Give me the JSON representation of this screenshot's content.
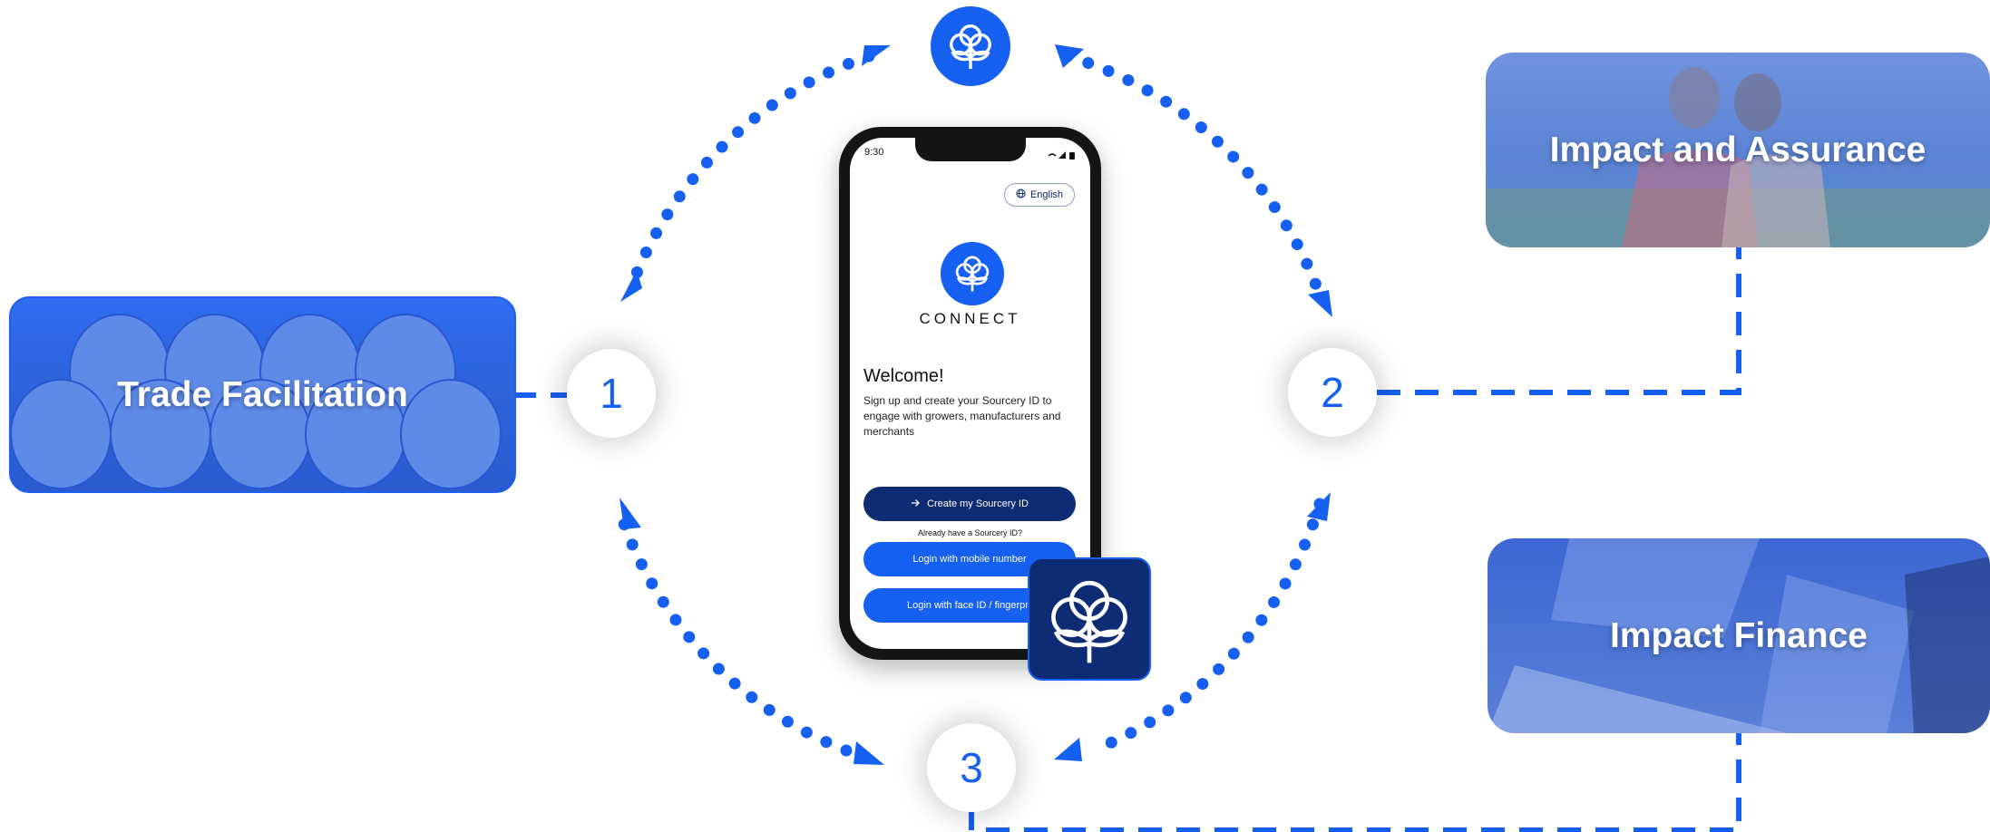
{
  "colors": {
    "accent": "#1560f0",
    "navy": "#0d2c73",
    "white": "#ffffff"
  },
  "cycle": {
    "nodes": [
      "1",
      "2",
      "3"
    ]
  },
  "cards": {
    "trade": "Trade Facilitation",
    "impact_assurance": "Impact and Assurance",
    "impact_finance": "Impact Finance"
  },
  "phone": {
    "time": "9:30",
    "language": "English",
    "brand": "CONNECT",
    "welcome": "Welcome!",
    "subtitle": "Sign up and create your Sourcery ID to engage with growers, manufacturers and merchants",
    "create_button": "Create my Sourcery ID",
    "already_text": "Already have a Sourcery ID?",
    "login_mobile": "Login with mobile number",
    "login_face": "Login with face ID / fingerprint"
  },
  "icons": {
    "top_logo": "cotton-flower-icon",
    "app_icon": "cotton-flower-icon",
    "globe": "globe-icon",
    "arrow": "arrow-right-icon"
  }
}
